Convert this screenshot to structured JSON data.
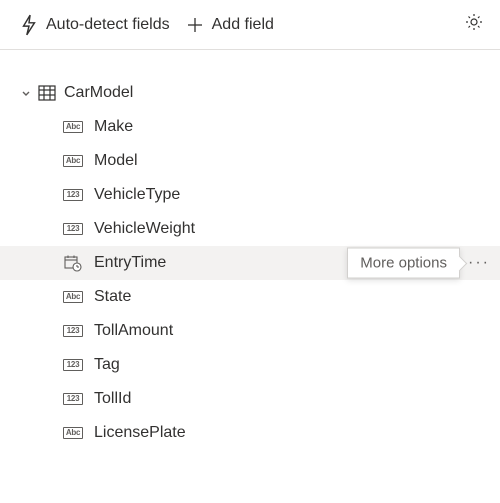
{
  "toolbar": {
    "autodetect_label": "Auto-detect fields",
    "addfield_label": "Add field"
  },
  "tooltip": "More options",
  "table": {
    "name": "CarModel",
    "expanded": true,
    "fields": [
      {
        "name": "Make",
        "type": "abc",
        "selected": false
      },
      {
        "name": "Model",
        "type": "abc",
        "selected": false
      },
      {
        "name": "VehicleType",
        "type": "num",
        "selected": false
      },
      {
        "name": "VehicleWeight",
        "type": "num",
        "selected": false
      },
      {
        "name": "EntryTime",
        "type": "dt",
        "selected": true
      },
      {
        "name": "State",
        "type": "abc",
        "selected": false
      },
      {
        "name": "TollAmount",
        "type": "num",
        "selected": false
      },
      {
        "name": "Tag",
        "type": "num",
        "selected": false
      },
      {
        "name": "TollId",
        "type": "num",
        "selected": false
      },
      {
        "name": "LicensePlate",
        "type": "abc",
        "selected": false
      }
    ]
  }
}
